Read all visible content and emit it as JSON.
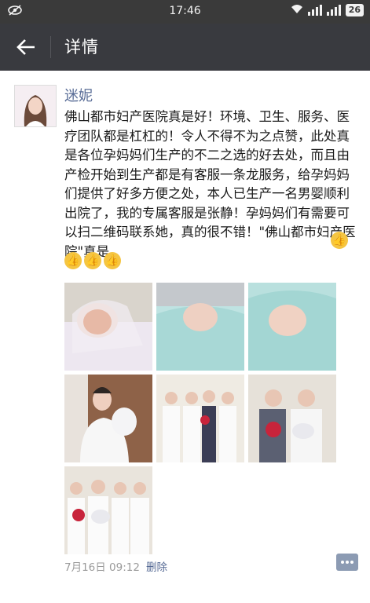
{
  "status_bar": {
    "time": "17:46",
    "battery": "26"
  },
  "header": {
    "title": "详情",
    "back_icon": "arrow-left-icon"
  },
  "post": {
    "author": "迷妮",
    "text": "佛山都市妇产医院真是好！环境、卫生、服务、医疗团队都是杠杠的！令人不得不为之点赞，此处真是各位孕妈妈们生产的不二之选的好去处，而且由产检开始到生产都是有客服一条龙服务，给孕妈妈们提供了好多方便之处，本人已生产一名男婴顺利出院了，我的专属客服是张静！孕妈妈们有需要可以扫二维码联系她，真的很不错！\"佛山都市妇产医院\"真是",
    "photo_count": 7,
    "timestamp": "7月16日 09:12",
    "delete_label": "删除"
  },
  "colors": {
    "header_bg": "#393a3f",
    "link_blue": "#576b95",
    "meta_gray": "#9b9b9b"
  }
}
